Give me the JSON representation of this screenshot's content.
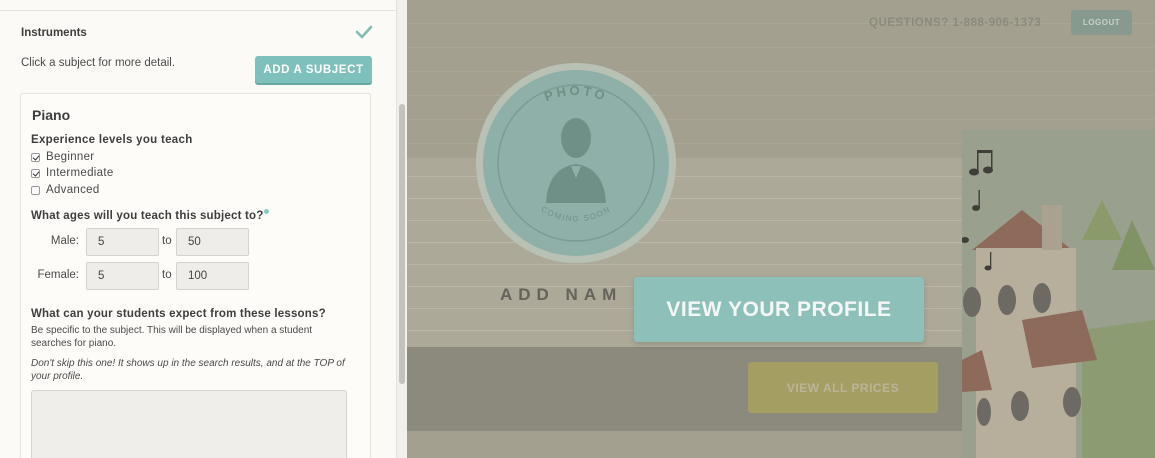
{
  "sidebar": {
    "section_title": "Instruments",
    "hint": "Click a subject for more detail.",
    "add_subject_label": "ADD A SUBJECT",
    "card": {
      "subject": "Piano",
      "experience_heading": "Experience levels you teach",
      "levels": [
        {
          "label": "Beginner",
          "checked": true
        },
        {
          "label": "Intermediate",
          "checked": true
        },
        {
          "label": "Advanced",
          "checked": false
        }
      ],
      "ages_heading": "What ages will you teach this subject to?",
      "male_label": "Male:",
      "female_label": "Female:",
      "to_label": "to",
      "male_from": "5",
      "male_to": "50",
      "female_from": "5",
      "female_to": "100",
      "expect_heading": "What can your students expect from these lessons?",
      "expect_desc": "Be specific to the subject. This will be displayed when a student searches for piano.",
      "expect_note": "Don't skip this one! It shows up in the search results, and at the TOP of your profile.",
      "expect_value": ""
    }
  },
  "header": {
    "questions": "QUESTIONS? 1-888-906-1373",
    "logout_label": "LOGOUT"
  },
  "profile": {
    "photo_top_text": "PHOTO",
    "photo_bottom_text": "COMING SOON",
    "add_name_text": "ADD NAM",
    "view_profile_label": "VIEW YOUR PROFILE",
    "view_prices_label": "VIEW ALL PRICES"
  },
  "icons": {
    "check": "check-icon",
    "info": "info-icon",
    "avatar": "person-silhouette-icon",
    "notes": "music-note-icon"
  },
  "colors": {
    "accent": "#7ec1bc",
    "check": "#7fbdb2",
    "overlay_button": "#8ec0ba"
  }
}
